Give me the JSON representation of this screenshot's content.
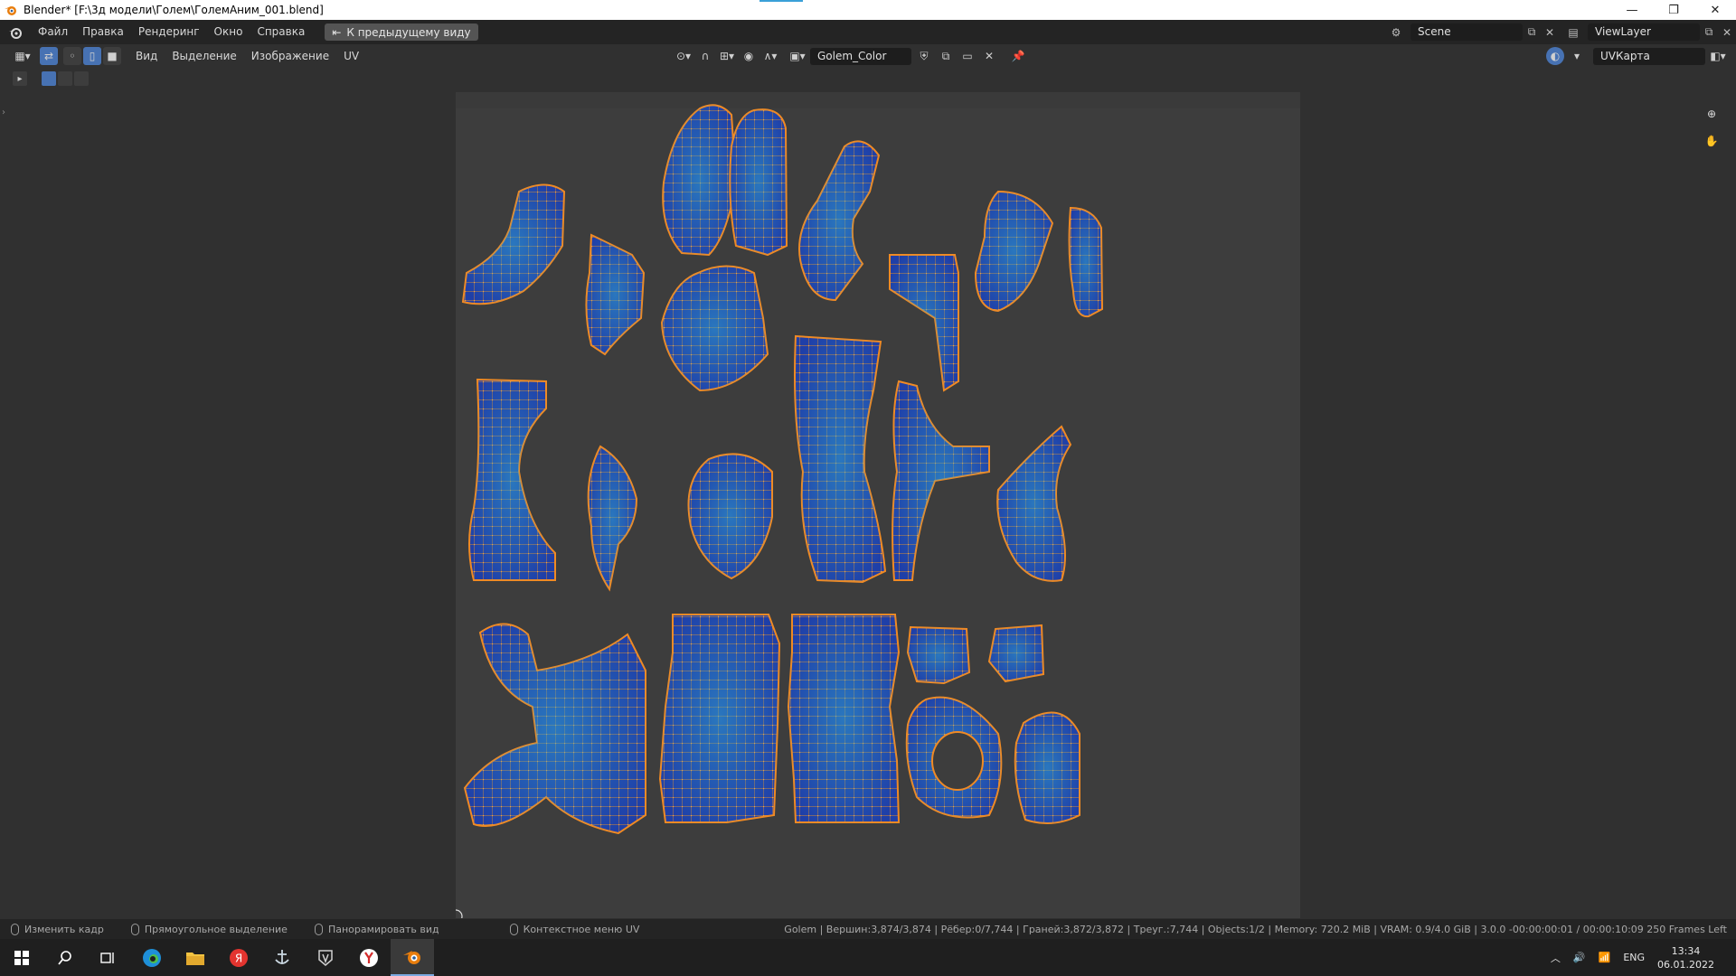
{
  "window": {
    "title": "Blender* [F:\\3д модели\\Голем\\ГолемАним_001.blend]",
    "minimize": "—",
    "maximize": "❐",
    "close": "✕"
  },
  "menu": {
    "items": [
      "Файл",
      "Правка",
      "Рендеринг",
      "Окно",
      "Справка"
    ],
    "back_label": "К предыдущему виду",
    "scene_label": "Scene",
    "viewlayer_label": "ViewLayer"
  },
  "header": {
    "menus": [
      "Вид",
      "Выделение",
      "Изображение",
      "UV"
    ],
    "image_name": "Golem_Color",
    "uvmap_name": "UVКарта"
  },
  "status": {
    "hints": [
      "Изменить кадр",
      "Прямоугольное выделение",
      "Панорамировать вид",
      "Контекстное меню UV"
    ],
    "stats": "Golem | Вершин:3,874/3,874 | Рёбер:0/7,744 | Граней:3,872/3,872 | Треуг.:7,744 | Objects:1/2 | Memory: 720.2 MiB | VRAM: 0.9/4.0 GiB | 3.0.0  -00:00:00:01 / 00:00:10:09  250 Frames Left"
  },
  "taskbar": {
    "lang": "ENG",
    "time": "13:34",
    "date": "06.01.2022"
  },
  "colors": {
    "accent": "#4772b3",
    "uv_face": "#1f3fa8",
    "uv_face_light": "#2e7fc0",
    "uv_vertex": "#f08a24",
    "canvas_bg": "#3d3d3d"
  }
}
